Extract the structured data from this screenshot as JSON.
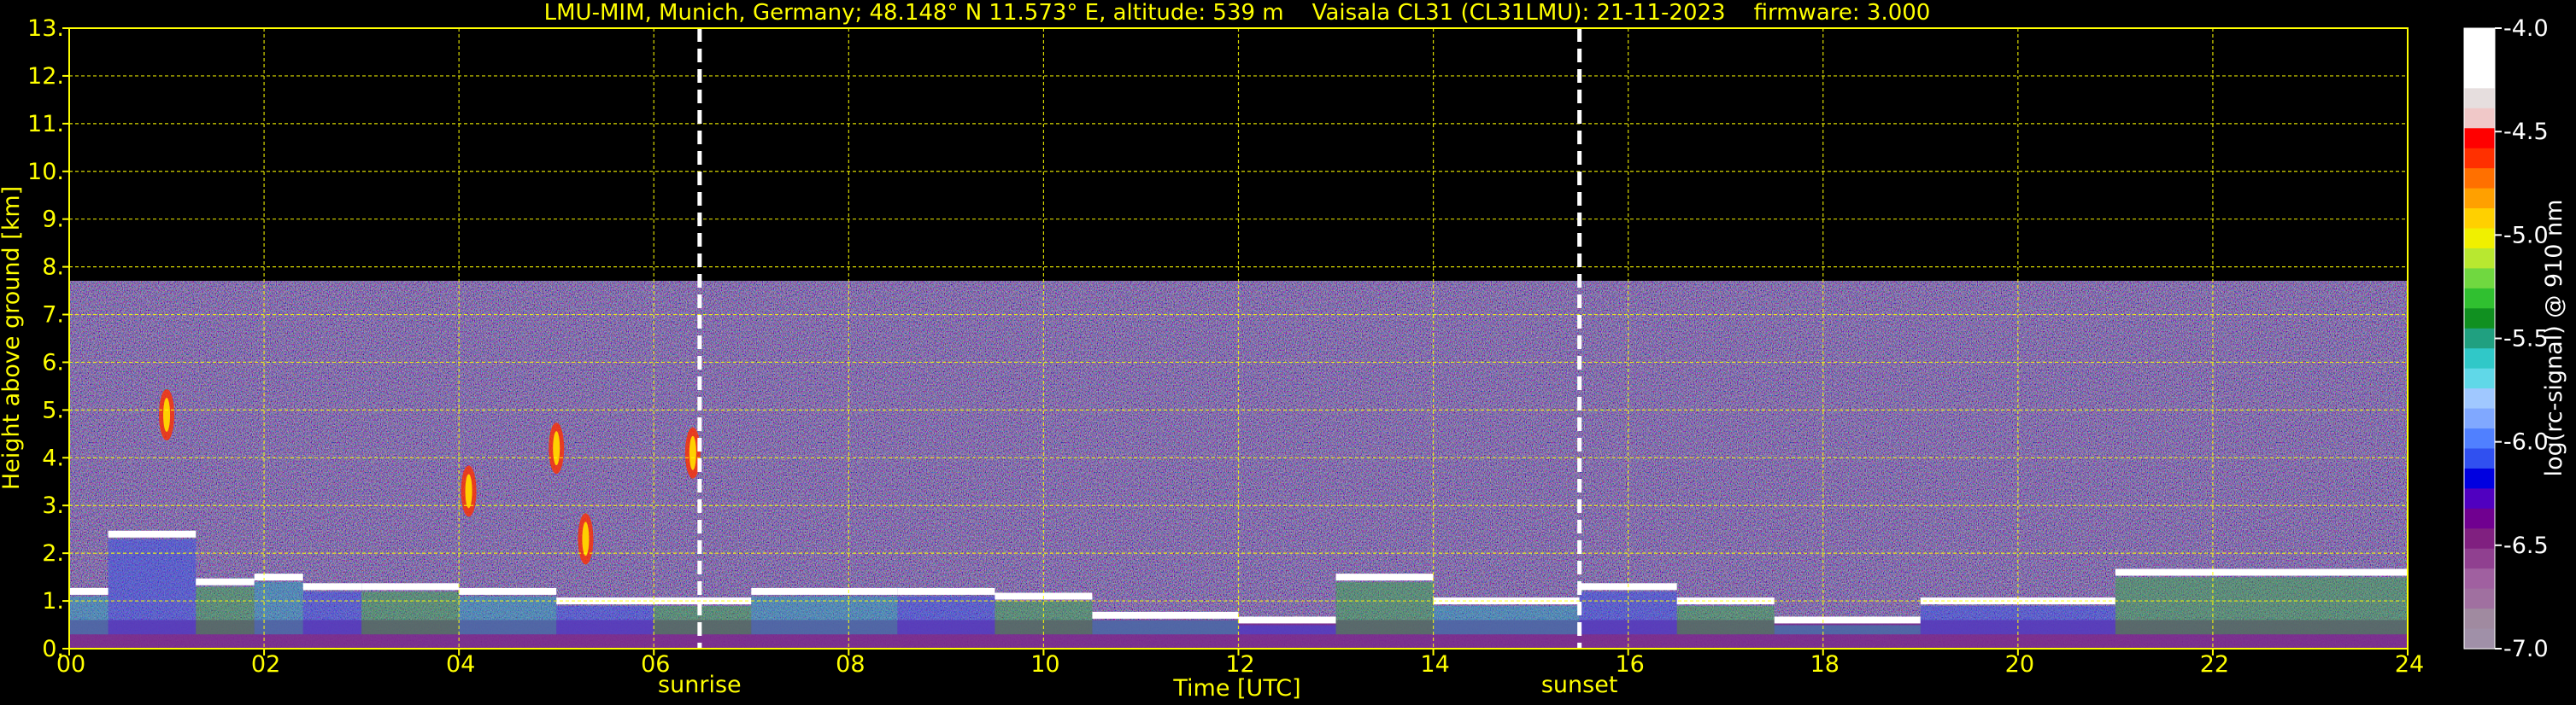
{
  "colors": {
    "background": "#000000",
    "text": "#ffff00",
    "grid": "#ffff00",
    "colorbar_text": "#ffffff"
  },
  "chart_data": {
    "type": "heatmap",
    "title": "LMU-MIM, Munich, Germany; 48.148° N 11.573° E, altitude: 539 m    Vaisala CL31 (CL31LMU): 21-11-2023    firmware: 3.000",
    "xlabel": "Time [UTC]",
    "ylabel": "Height above ground [km]",
    "xlim": [
      0,
      24
    ],
    "ylim": [
      0,
      13
    ],
    "x_ticks": [
      0,
      2,
      4,
      6,
      8,
      10,
      12,
      14,
      16,
      18,
      20,
      22,
      24
    ],
    "x_tick_labels": [
      "00",
      "02",
      "04",
      "06",
      "08",
      "10",
      "12",
      "14",
      "16",
      "18",
      "20",
      "22",
      "24"
    ],
    "y_ticks": [
      0,
      1,
      2,
      3,
      4,
      5,
      6,
      7,
      8,
      9,
      10,
      11,
      12,
      13
    ],
    "y_tick_labels": [
      "0.",
      "1.",
      "2.",
      "3.",
      "4.",
      "5.",
      "6.",
      "7.",
      "8.",
      "9.",
      "10.",
      "11.",
      "12.",
      "13."
    ],
    "grid": true,
    "data_top_km": 7.7,
    "events": [
      {
        "name": "sunrise",
        "x": 6.47
      },
      {
        "name": "sunset",
        "x": 15.5
      }
    ],
    "cloud_layers": [
      {
        "x_start": 0.0,
        "x_end": 0.4,
        "height": 1.2
      },
      {
        "x_start": 0.4,
        "x_end": 1.3,
        "height": 2.4
      },
      {
        "x_start": 1.3,
        "x_end": 1.9,
        "height": 1.4
      },
      {
        "x_start": 1.9,
        "x_end": 2.4,
        "height": 1.5
      },
      {
        "x_start": 2.4,
        "x_end": 3.0,
        "height": 1.3
      },
      {
        "x_start": 3.0,
        "x_end": 4.0,
        "height": 1.3
      },
      {
        "x_start": 4.0,
        "x_end": 5.0,
        "height": 1.2
      },
      {
        "x_start": 5.0,
        "x_end": 6.0,
        "height": 1.0
      },
      {
        "x_start": 6.0,
        "x_end": 7.0,
        "height": 1.0
      },
      {
        "x_start": 7.0,
        "x_end": 8.5,
        "height": 1.2
      },
      {
        "x_start": 8.5,
        "x_end": 9.5,
        "height": 1.2
      },
      {
        "x_start": 9.5,
        "x_end": 10.5,
        "height": 1.1
      },
      {
        "x_start": 10.5,
        "x_end": 12.0,
        "height": 0.7
      },
      {
        "x_start": 12.0,
        "x_end": 13.0,
        "height": 0.6
      },
      {
        "x_start": 13.0,
        "x_end": 14.0,
        "height": 1.5
      },
      {
        "x_start": 14.0,
        "x_end": 15.5,
        "height": 1.0
      },
      {
        "x_start": 15.5,
        "x_end": 16.5,
        "height": 1.3
      },
      {
        "x_start": 16.5,
        "x_end": 17.5,
        "height": 1.0
      },
      {
        "x_start": 17.5,
        "x_end": 19.0,
        "height": 0.6
      },
      {
        "x_start": 19.0,
        "x_end": 21.0,
        "height": 1.0
      },
      {
        "x_start": 21.0,
        "x_end": 24.0,
        "height": 1.6
      }
    ],
    "mid_clouds": [
      {
        "x": 1.0,
        "height": 4.9
      },
      {
        "x": 5.0,
        "height": 4.2
      },
      {
        "x": 6.4,
        "height": 4.1
      },
      {
        "x": 4.1,
        "height": 3.3
      },
      {
        "x": 5.3,
        "height": 2.3
      }
    ],
    "colorbar": {
      "label": "log(rc-signal) @ 910 nm",
      "vmin": -7.0,
      "vmax": -4.0,
      "ticks": [
        -4.0,
        -4.5,
        -5.0,
        -5.5,
        -6.0,
        -6.5,
        -7.0
      ],
      "tick_labels": [
        "-4.0",
        "-4.5",
        "-5.0",
        "-5.5",
        "-6.0",
        "-6.5",
        "-7.0"
      ],
      "colors_top_to_bottom": [
        "#ffffff",
        "#ffffff",
        "#ffffff",
        "#e6dede",
        "#f0c8c8",
        "#ff0000",
        "#ff3000",
        "#ff7000",
        "#ffa000",
        "#ffd000",
        "#f0f000",
        "#b8e830",
        "#70d840",
        "#30c030",
        "#109020",
        "#20a080",
        "#30c8c8",
        "#60d8e8",
        "#a0c8ff",
        "#80a8ff",
        "#5080ff",
        "#3050f0",
        "#0000e0",
        "#5000c0",
        "#700090",
        "#802080",
        "#904090",
        "#a060a0",
        "#a070a0",
        "#a08aa0",
        "#a090a8"
      ]
    }
  }
}
